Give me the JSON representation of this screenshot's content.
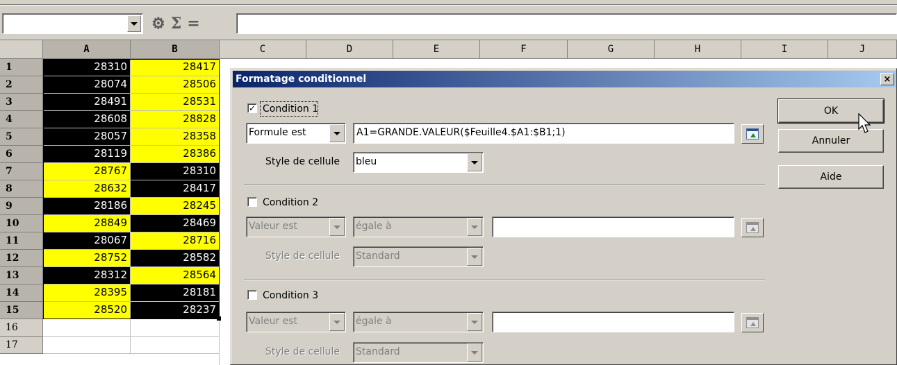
{
  "formula_bar": {
    "name_box_value": "",
    "icons": [
      "function-wizard-icon",
      "sum-icon",
      "equals-icon"
    ],
    "icon_glyphs": [
      "⚙",
      "Σ",
      "="
    ],
    "formula_value": ""
  },
  "sheet": {
    "columns": [
      "A",
      "B",
      "C",
      "D",
      "E",
      "F",
      "G",
      "H",
      "I",
      "J"
    ],
    "rows": [
      {
        "num": "1",
        "a": "28310",
        "a_style": "black",
        "b": "28417",
        "b_style": "yellow"
      },
      {
        "num": "2",
        "a": "28074",
        "a_style": "black",
        "b": "28506",
        "b_style": "yellow"
      },
      {
        "num": "3",
        "a": "28491",
        "a_style": "black",
        "b": "28531",
        "b_style": "yellow"
      },
      {
        "num": "4",
        "a": "28608",
        "a_style": "black",
        "b": "28828",
        "b_style": "yellow"
      },
      {
        "num": "5",
        "a": "28057",
        "a_style": "black",
        "b": "28358",
        "b_style": "yellow"
      },
      {
        "num": "6",
        "a": "28119",
        "a_style": "black",
        "b": "28386",
        "b_style": "yellow"
      },
      {
        "num": "7",
        "a": "28767",
        "a_style": "yellow",
        "b": "28310",
        "b_style": "black"
      },
      {
        "num": "8",
        "a": "28632",
        "a_style": "yellow",
        "b": "28417",
        "b_style": "black"
      },
      {
        "num": "9",
        "a": "28186",
        "a_style": "black",
        "b": "28245",
        "b_style": "yellow"
      },
      {
        "num": "10",
        "a": "28849",
        "a_style": "yellow",
        "b": "28469",
        "b_style": "black"
      },
      {
        "num": "11",
        "a": "28067",
        "a_style": "black",
        "b": "28716",
        "b_style": "yellow"
      },
      {
        "num": "12",
        "a": "28752",
        "a_style": "yellow",
        "b": "28582",
        "b_style": "black"
      },
      {
        "num": "13",
        "a": "28312",
        "a_style": "black",
        "b": "28564",
        "b_style": "yellow"
      },
      {
        "num": "14",
        "a": "28395",
        "a_style": "yellow",
        "b": "28181",
        "b_style": "black"
      },
      {
        "num": "15",
        "a": "28520",
        "a_style": "yellow",
        "b": "28237",
        "b_style": "black"
      },
      {
        "num": "16",
        "a": "",
        "a_style": "empty",
        "b": "",
        "b_style": "empty"
      },
      {
        "num": "17",
        "a": "",
        "a_style": "empty",
        "b": "",
        "b_style": "empty"
      }
    ],
    "colors": {
      "black": "#000000",
      "yellow": "#ffff00"
    }
  },
  "dialog": {
    "title": "Formatage conditionnel",
    "close_label": "×",
    "condition1": {
      "checked": true,
      "check_glyph": "✓",
      "label": "Condition 1",
      "type_value": "Formule est",
      "formula": "A1=GRANDE.VALEUR($Feuille4.$A1:$B1;1)",
      "style_label": "Style de cellule",
      "style_value": "bleu"
    },
    "condition2": {
      "checked": false,
      "label": "Condition 2",
      "type_value": "Valeur est",
      "operator_value": "égale à",
      "value": "",
      "style_label": "Style de cellule",
      "style_value": "Standard"
    },
    "condition3": {
      "checked": false,
      "label": "Condition 3",
      "type_value": "Valeur est",
      "operator_value": "égale à",
      "value": "",
      "style_label": "Style de cellule",
      "style_value": "Standard"
    },
    "buttons": {
      "ok": "OK",
      "cancel": "Annuler",
      "help": "Aide"
    }
  }
}
